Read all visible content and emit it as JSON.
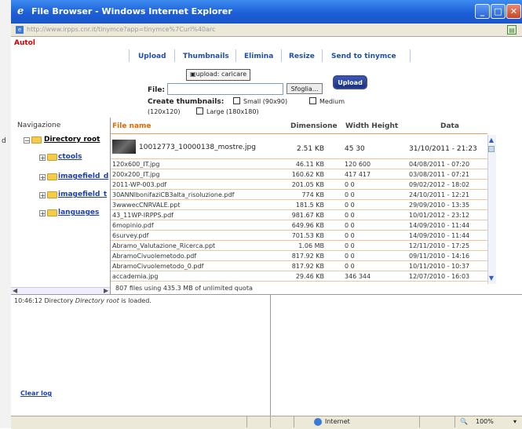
{
  "desktop": {
    "letter": "d"
  },
  "window": {
    "title": "File Browser - Windows Internet Explorer",
    "url": "http://www.irpps.cnr.it/tinymce?app=tinymce%7Curl%40arc"
  },
  "page": {
    "autol": "Autol",
    "toolbar": {
      "upload": "Upload",
      "thumbnails": "Thumbnails",
      "elimina": "Elimina",
      "resize": "Resize",
      "send": "Send to tinymce"
    },
    "tooltip": "upload: caricare",
    "file_label": "File:",
    "file_value": "",
    "browse_label": "Sfoglia...",
    "upload_button": "Upload",
    "create_thumbs_label": "Create thumbnails:",
    "small_label": "Small (90x90)",
    "medium_label": "Medium",
    "medium_size": "(120x120)",
    "large_label": "Large (180x180)"
  },
  "nav": {
    "title": "Navigazione",
    "root": "Directory root",
    "folders": [
      "ctools",
      "imagefield_d",
      "imagefield_t",
      "languages"
    ]
  },
  "table": {
    "headers": {
      "name": "File name",
      "dimension": "Dimensione",
      "wh": "Width Height",
      "date": "Data"
    },
    "thumb_row": {
      "name": "10012773_10000138_mostre.jpg",
      "size": "2.51 KB",
      "wh": "45 30",
      "date": "31/10/2011 - 21:23"
    },
    "rows": [
      {
        "name": "120x600_IT.jpg",
        "size": "46.11 KB",
        "wh": "120 600",
        "date": "04/08/2011 - 07:20"
      },
      {
        "name": "200x200_IT.jpg",
        "size": "160.62 KB",
        "wh": "417 417",
        "date": "03/08/2011 - 07:21"
      },
      {
        "name": "2011-WP-003.pdf",
        "size": "201.05 KB",
        "wh": "0 0",
        "date": "09/02/2012 - 18:02"
      },
      {
        "name": "30ANNIbonifaziCB3alta_risoluzione.pdf",
        "size": "774 KB",
        "wh": "0 0",
        "date": "24/10/2011 - 12:21"
      },
      {
        "name": "3wwwecCNRVALE.ppt",
        "size": "181.5 KB",
        "wh": "0 0",
        "date": "29/09/2010 - 13:35"
      },
      {
        "name": "43_11WP-IRPPS.pdf",
        "size": "981.67 KB",
        "wh": "0 0",
        "date": "10/01/2012 - 23:12"
      },
      {
        "name": "6mopinio.pdf",
        "size": "649.96 KB",
        "wh": "0 0",
        "date": "14/09/2010 - 11:44"
      },
      {
        "name": "6survey.pdf",
        "size": "701.53 KB",
        "wh": "0 0",
        "date": "14/09/2010 - 11:44"
      },
      {
        "name": "Abramo_Valutazione_Ricerca.ppt",
        "size": "1.06 MB",
        "wh": "0 0",
        "date": "12/11/2010 - 17:25"
      },
      {
        "name": "AbramoCivuolemetodo.pdf",
        "size": "817.92 KB",
        "wh": "0 0",
        "date": "09/11/2010 - 14:16"
      },
      {
        "name": "AbramoCivuolemetodo_0.pdf",
        "size": "817.92 KB",
        "wh": "0 0",
        "date": "10/11/2010 - 10:37"
      },
      {
        "name": "accademia.jpg",
        "size": "29.46 KB",
        "wh": "346 344",
        "date": "12/07/2010 - 16:03"
      }
    ],
    "status": "807 files using 435.3 MB of unlimited quota"
  },
  "log": {
    "time": "10:46:12",
    "pre": "Directory",
    "dir": "Directory root",
    "post": "is loaded.",
    "clear": "Clear log"
  },
  "statusbar": {
    "zone": "Internet",
    "zoom": "100%"
  },
  "colors": {
    "title_blue": "#1c5fd8",
    "header_orange": "#e06a00",
    "link_blue": "#1d3fb0",
    "autol_red": "#d40000"
  }
}
